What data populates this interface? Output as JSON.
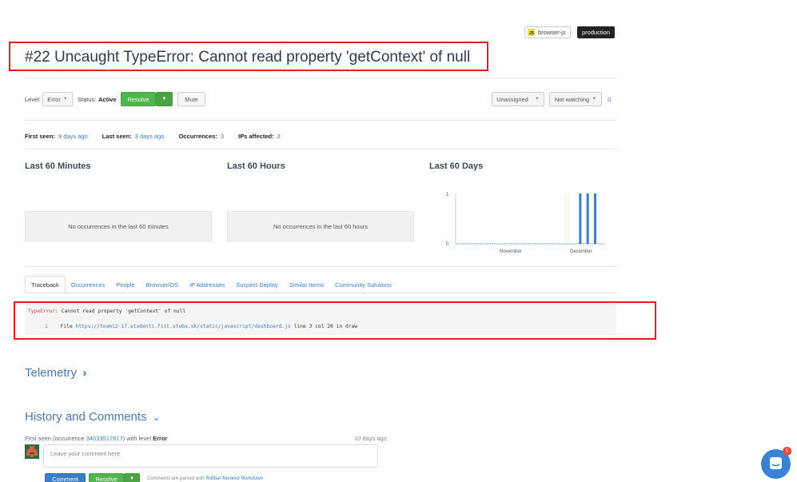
{
  "tags": {
    "lang": "browser-js",
    "env": "production"
  },
  "title": "#22 Uncaught TypeError: Cannot read property 'getContext' of null",
  "controls": {
    "level_label": "Level:",
    "level_value": "Error",
    "status_label": "Status:",
    "status_value": "Active",
    "resolve": "Resolve",
    "mute": "Mute",
    "assignee": "Unassigned",
    "watching": "Not watching",
    "watch_count": "0"
  },
  "stats": {
    "first_seen_label": "First seen:",
    "first_seen": "9 days ago",
    "last_seen_label": "Last seen:",
    "last_seen": "3 days ago",
    "occurrences_label": "Occurrences:",
    "occurrences": "3",
    "ips_label": "IPs affected:",
    "ips": "2"
  },
  "panels": {
    "minutes_title": "Last 60 Minutes",
    "minutes_empty": "No occurrences in the last 60 minutes",
    "hours_title": "Last 60 Hours",
    "hours_empty": "No occurrences in the last 60 hours",
    "days_title": "Last 60 Days"
  },
  "chart_data": {
    "type": "bar",
    "title": "Last 60 Days",
    "x_tick_labels": [
      "November",
      "December"
    ],
    "y_tick_labels": [
      "0",
      "1"
    ],
    "ylim": [
      0,
      1
    ],
    "xlim": [
      0,
      60
    ],
    "bar_x": [
      50,
      53,
      56
    ],
    "values": [
      1,
      1,
      1
    ],
    "bar_color": "#3a7fc6"
  },
  "tabs": [
    "Traceback",
    "Occurrences",
    "People",
    "Browser/OS",
    "IP Addresses",
    "Suspect Deploy",
    "Similar Items",
    "Community Solutions"
  ],
  "traceback": {
    "error_type": "TypeError",
    "error_msg": ": Cannot read property 'getContext' of null",
    "frame_num": "1",
    "file_prefix": "File ",
    "file_url": "https://team12-17.studenti.fiit.stuba.sk/static/javascript/dashboard.js",
    "file_suffix": " line 3 col 20 in draw"
  },
  "telemetry": {
    "label": "Telemetry",
    "chevron": "›"
  },
  "history": {
    "label": "History and Comments",
    "chevron": "⌄",
    "first_seen_prefix": "First seen (occurrence ",
    "occurrence_id": "34033517817",
    "first_seen_mid": ") with level ",
    "level": "Error",
    "ago": "10 days ago",
    "comment_placeholder": "Leave your comment here",
    "comment_btn": "Comment",
    "resolve_btn": "Resolve",
    "parsed_prefix": "Comments are parsed with ",
    "parsed_link": "Rollbar-flavored Markdown"
  },
  "chat_badge": "5"
}
